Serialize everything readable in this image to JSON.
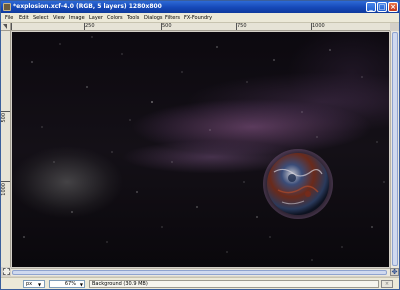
{
  "window": {
    "title": "*explosion.xcf-4.0 (RGB, 5 layers) 1280x800"
  },
  "menubar": {
    "items": [
      "File",
      "Edit",
      "Select",
      "View",
      "Image",
      "Layer",
      "Colors",
      "Tools",
      "Dialogs",
      "Filters",
      "FX-Foundry"
    ]
  },
  "rulers": {
    "horizontal_labels": [
      "250",
      "500",
      "750",
      "1000"
    ],
    "vertical_labels": [
      "500",
      "1000"
    ]
  },
  "statusbar": {
    "coords": "",
    "unit": "px",
    "zoom": "67%",
    "message": "Background (30.9 MB)",
    "cancel_label": "×"
  },
  "scene": {
    "planet_colors": [
      "#2a3a5c",
      "#6a2a1a",
      "#c8c8d0",
      "#3a4c78"
    ],
    "nebula_color": "#8a5a96"
  }
}
